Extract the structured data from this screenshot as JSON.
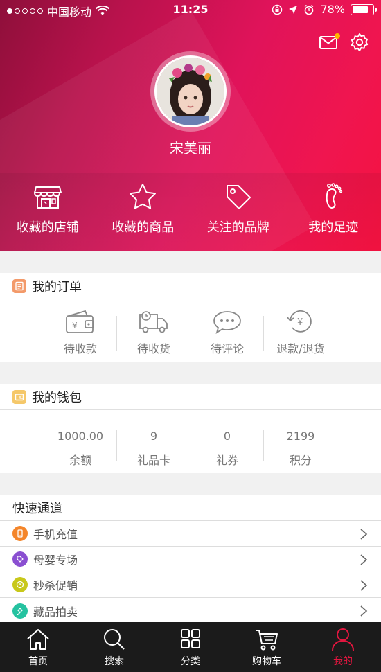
{
  "status_bar": {
    "carrier": "中国移动",
    "time": "11:25",
    "battery_percent": "78%",
    "battery_level": 0.78
  },
  "profile": {
    "username": "宋美丽"
  },
  "favorites": [
    {
      "label": "收藏的店铺",
      "icon": "store-icon"
    },
    {
      "label": "收藏的商品",
      "icon": "star-icon"
    },
    {
      "label": "关注的品牌",
      "icon": "tag-icon"
    },
    {
      "label": "我的足迹",
      "icon": "footprint-icon"
    }
  ],
  "orders": {
    "title": "我的订单",
    "items": [
      {
        "label": "待收款",
        "icon": "wallet-icon"
      },
      {
        "label": "待收货",
        "icon": "truck-icon"
      },
      {
        "label": "待评论",
        "icon": "comment-icon"
      },
      {
        "label": "退款/退货",
        "icon": "refund-icon"
      }
    ]
  },
  "wallet": {
    "title": "我的钱包",
    "items": [
      {
        "value": "1000.00",
        "label": "余额"
      },
      {
        "value": "9",
        "label": "礼品卡"
      },
      {
        "value": "0",
        "label": "礼券"
      },
      {
        "value": "2199",
        "label": "积分"
      }
    ]
  },
  "quick": {
    "title": "快速通道",
    "items": [
      {
        "label": "手机充值",
        "color": "#f4852a"
      },
      {
        "label": "母婴专场",
        "color": "#8a4fd1"
      },
      {
        "label": "秒杀促销",
        "color": "#c8c81a"
      },
      {
        "label": "藏品拍卖",
        "color": "#25c2a0"
      }
    ]
  },
  "tabbar": [
    {
      "label": "首页"
    },
    {
      "label": "搜索"
    },
    {
      "label": "分类"
    },
    {
      "label": "购物车"
    },
    {
      "label": "我的"
    }
  ],
  "colors": {
    "accent": "#e2163f",
    "hero_start": "#8e0f3a",
    "hero_end": "#f51240"
  }
}
